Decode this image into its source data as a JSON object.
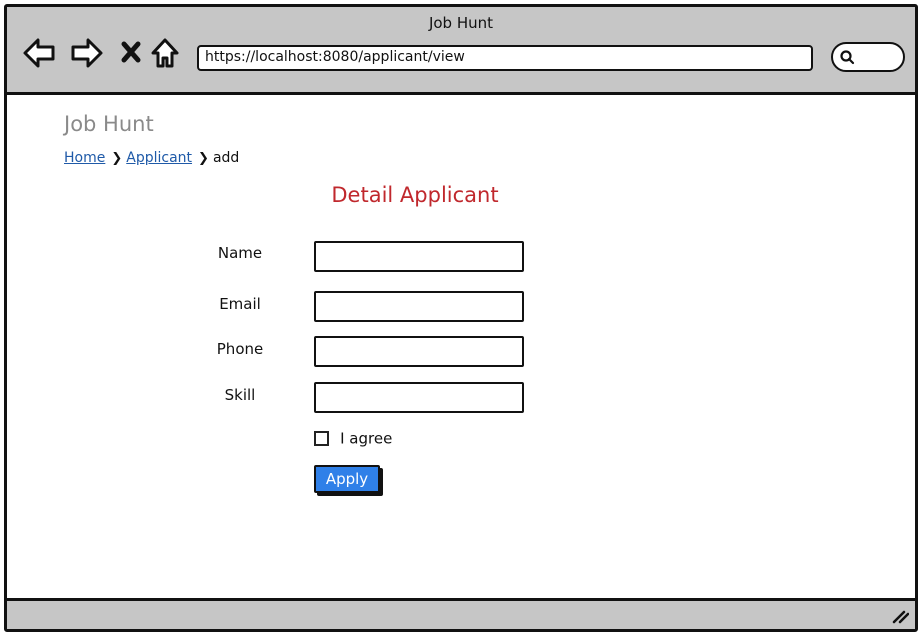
{
  "window": {
    "title": "Job Hunt"
  },
  "toolbar": {
    "address": "https://localhost:8080/applicant/view",
    "icons": [
      "back-arrow-icon",
      "forward-arrow-icon",
      "close-icon",
      "home-icon",
      "search-icon"
    ]
  },
  "page": {
    "app_heading": "Job Hunt",
    "breadcrumb": {
      "home": "Home",
      "applicant": "Applicant",
      "current": "add"
    },
    "title": "Detail Applicant"
  },
  "form": {
    "name_label": "Name",
    "name_value": "",
    "email_label": "Email",
    "email_value": "",
    "phone_label": "Phone",
    "phone_value": "",
    "skill_label": "Skill",
    "skill_value": "",
    "agree_label": "I agree",
    "apply_label": "Apply"
  },
  "colors": {
    "titlebar": "#c6c6c6",
    "heading_gray": "#8a8a8a",
    "link_blue": "#1f5aa8",
    "title_red": "#c0282d",
    "button_blue": "#2f80e8"
  }
}
